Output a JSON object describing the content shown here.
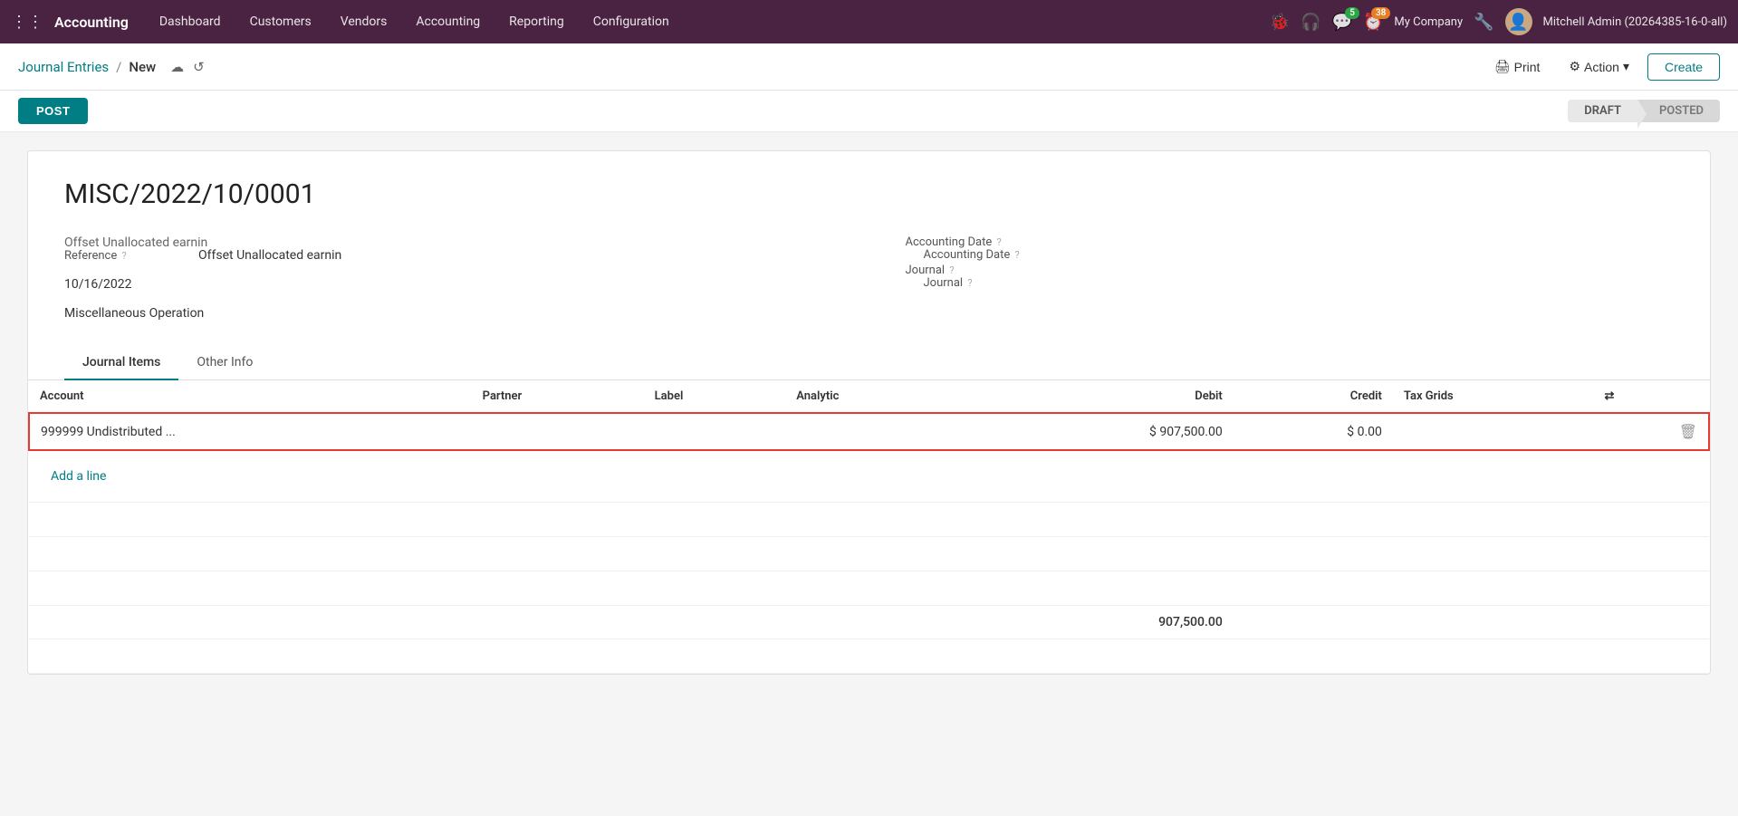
{
  "topNav": {
    "appName": "Accounting",
    "items": [
      {
        "label": "Dashboard",
        "key": "dashboard"
      },
      {
        "label": "Customers",
        "key": "customers"
      },
      {
        "label": "Vendors",
        "key": "vendors"
      },
      {
        "label": "Accounting",
        "key": "accounting"
      },
      {
        "label": "Reporting",
        "key": "reporting"
      },
      {
        "label": "Configuration",
        "key": "configuration"
      }
    ],
    "messageBadge": "5",
    "activityBadge": "38",
    "companyName": "My Company",
    "userName": "Mitchell Admin (20264385-16-0-all)"
  },
  "breadcrumb": {
    "parent": "Journal Entries",
    "separator": "/",
    "current": "New",
    "printLabel": "Print",
    "actionLabel": "Action",
    "createLabel": "Create"
  },
  "toolbar": {
    "postButton": "POST",
    "statusDraft": "DRAFT",
    "statusPosted": "POSTED"
  },
  "form": {
    "recordTitle": "MISC/2022/10/0001",
    "referenceLabel": "Reference",
    "referenceHelp": "?",
    "referenceValue": "Offset Unallocated earnin",
    "dateValue": "10/16/2022",
    "journalLabel": "Journal",
    "journalHelp": "?",
    "journalValue": "Miscellaneous Operation",
    "accountingDateLabel": "Accounting Date",
    "accountingDateHelp": "?"
  },
  "tabs": [
    {
      "label": "Journal Items",
      "key": "journal-items",
      "active": true
    },
    {
      "label": "Other Info",
      "key": "other-info",
      "active": false
    }
  ],
  "table": {
    "columns": [
      {
        "label": "Account",
        "key": "account"
      },
      {
        "label": "Partner",
        "key": "partner"
      },
      {
        "label": "Label",
        "key": "label"
      },
      {
        "label": "Analytic",
        "key": "analytic"
      },
      {
        "label": "Debit",
        "key": "debit"
      },
      {
        "label": "Credit",
        "key": "credit"
      },
      {
        "label": "Tax Grids",
        "key": "tax-grids"
      },
      {
        "label": "⇄",
        "key": "controls"
      }
    ],
    "rows": [
      {
        "account": "999999 Undistributed ...",
        "partner": "",
        "label": "",
        "analytic": "",
        "debit": "$ 907,500.00",
        "credit": "$ 0.00",
        "taxGrids": "",
        "highlighted": true
      }
    ],
    "addLineLabel": "Add a line",
    "totalDebit": "907,500.00",
    "totalCredit": ""
  }
}
